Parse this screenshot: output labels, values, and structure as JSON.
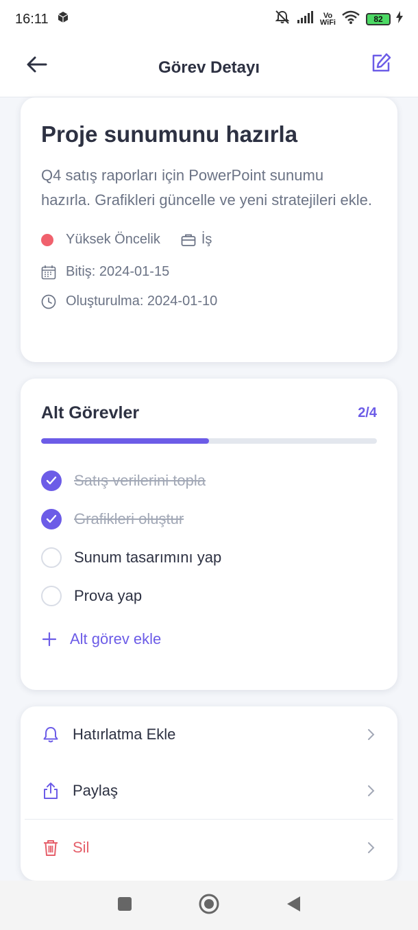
{
  "status_bar": {
    "time": "16:11",
    "volte_top": "Vo",
    "volte_bottom": "WiFi",
    "battery": "82"
  },
  "header": {
    "title": "Görev Detayı"
  },
  "task": {
    "title": "Proje sunumunu hazırla",
    "description": "Q4 satış raporları için PowerPoint sunumu hazırla. Grafikleri güncelle ve yeni stratejileri ekle.",
    "priority": "Yüksek Öncelik",
    "priority_color": "#f0616d",
    "category": "İş",
    "due": "Bitiş: 2024-01-15",
    "created": "Oluşturulma: 2024-01-10"
  },
  "subtasks": {
    "title": "Alt Görevler",
    "count": "2/4",
    "progress": 0.5,
    "items": [
      {
        "label": "Satış verilerini topla",
        "done": true
      },
      {
        "label": "Grafikleri oluştur",
        "done": true
      },
      {
        "label": "Sunum tasarımını yap",
        "done": false
      },
      {
        "label": "Prova yap",
        "done": false
      }
    ],
    "add_label": "Alt görev ekle"
  },
  "actions": {
    "reminder": "Hatırlatma Ekle",
    "share": "Paylaş",
    "delete": "Sil"
  },
  "colors": {
    "accent": "#6c5ce7",
    "danger": "#e55f6a"
  }
}
